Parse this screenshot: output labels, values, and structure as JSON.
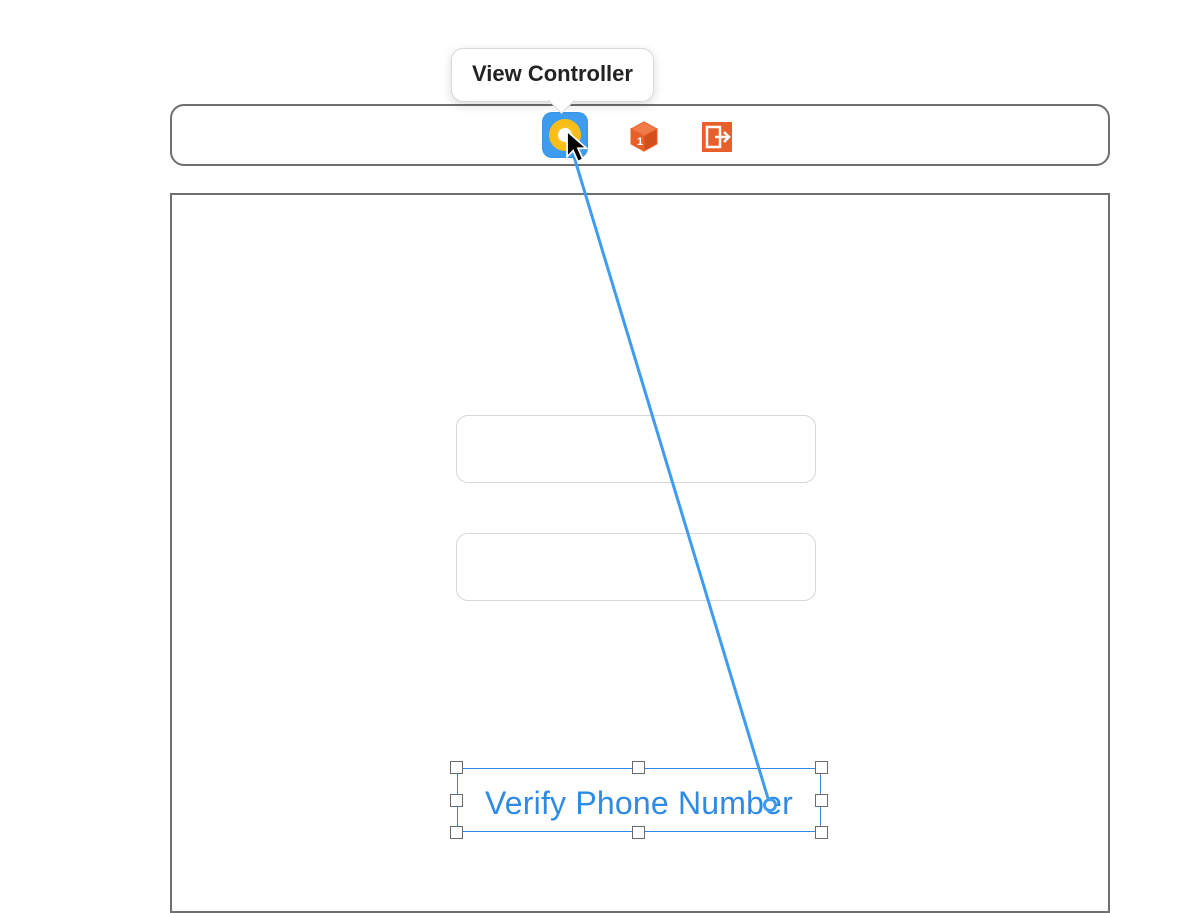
{
  "tooltip": {
    "label": "View Controller"
  },
  "scene_dock": {
    "icons": {
      "view_controller": "view-controller-icon",
      "first_responder": "first-responder-icon",
      "exit": "exit-icon"
    }
  },
  "canvas": {
    "textfield1_value": "",
    "textfield2_value": "",
    "selected_button": {
      "label": "Verify Phone Number"
    }
  },
  "colors": {
    "selection_blue": "#2f8ae6",
    "xcode_orange": "#e95f2a",
    "vc_yellow": "#f8be17",
    "vc_bg_blue": "#3e9cf0"
  }
}
